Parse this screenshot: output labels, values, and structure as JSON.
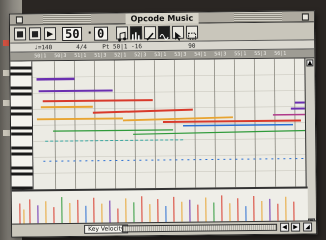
{
  "window": {
    "title": "Opcode Music"
  },
  "toolbar": {
    "record_label": "■",
    "stop_label": "■",
    "play_label": "▶",
    "counter_measure": "50",
    "counter_sep": "·",
    "counter_beat": "0",
    "icons": [
      "note-icon",
      "bars-icon",
      "pencil-icon",
      "wave-icon",
      "arrow-tool-icon",
      "marquee-tool-icon"
    ]
  },
  "infobar": {
    "tempo": "♩=140",
    "time_sig": "4/4",
    "position": "Pt 50|1 -16",
    "zoom": "90"
  },
  "ruler": {
    "ticks": [
      "50|1",
      "50|3",
      "51|1",
      "51|3",
      "52|1",
      "52|3",
      "53|1",
      "53|3",
      "54|1",
      "54|3",
      "55|1",
      "55|3",
      "56|1"
    ]
  },
  "velocity_lane": {
    "label": "Key Velocity"
  },
  "colors": {
    "note_colors": [
      "#6a2fb0",
      "#d8392b",
      "#e8a431",
      "#2f9a3a",
      "#2a6fd3",
      "#b03a8a",
      "#3aa6a0"
    ]
  }
}
